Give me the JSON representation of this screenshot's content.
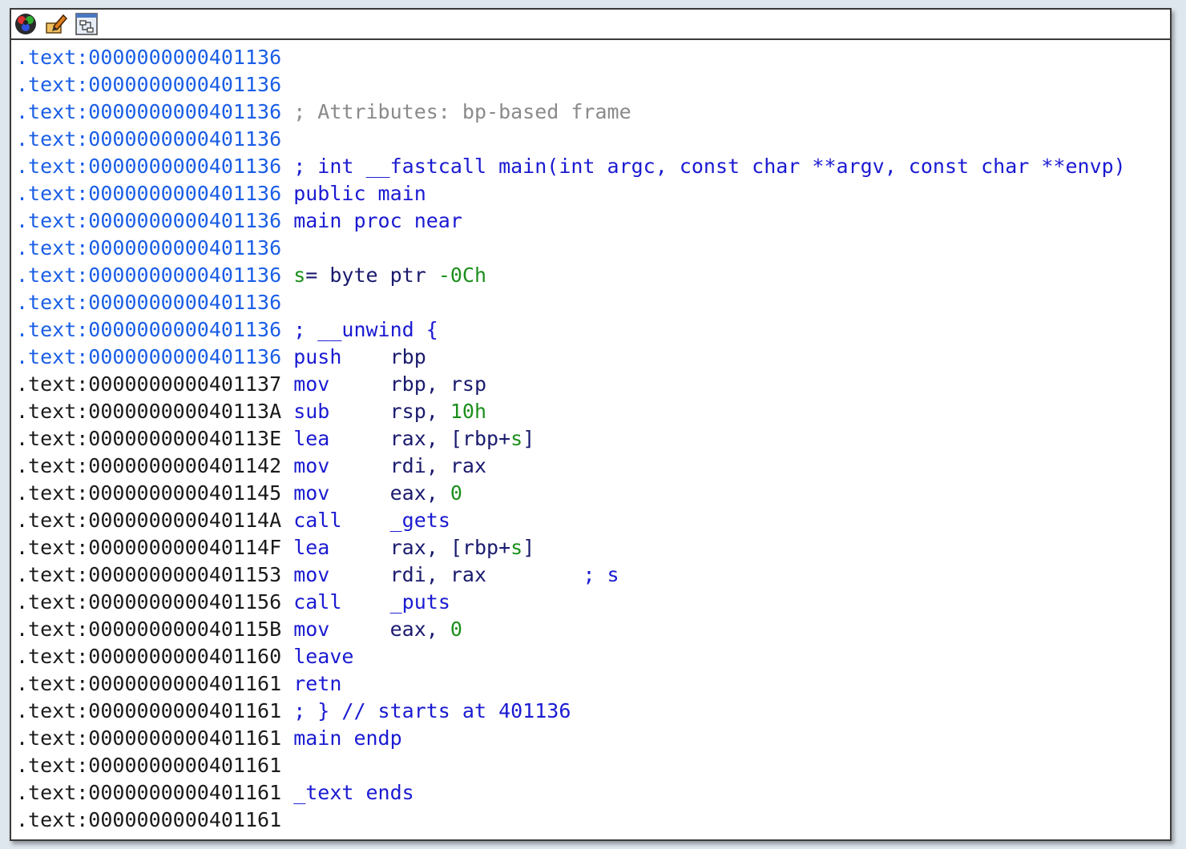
{
  "toolbar": {
    "icons": [
      "graph-view-icon",
      "edit-pencil-icon",
      "flowchart-icon"
    ]
  },
  "colors": {
    "address_blue": "#1a5ee6",
    "address_black": "#1a1a1a",
    "comment_gray": "#8a8a8a",
    "keyword_blue": "#1a1ad2",
    "number_green": "#1b8f1b"
  },
  "lines": [
    {
      "addr": ".text:0000000000401136",
      "addr_style": "blue",
      "parts": []
    },
    {
      "addr": ".text:0000000000401136",
      "addr_style": "blue",
      "parts": []
    },
    {
      "addr": ".text:0000000000401136",
      "addr_style": "blue",
      "parts": [
        {
          "t": " ; Attributes: bp-based frame",
          "c": "comment"
        }
      ]
    },
    {
      "addr": ".text:0000000000401136",
      "addr_style": "blue",
      "parts": []
    },
    {
      "addr": ".text:0000000000401136",
      "addr_style": "blue",
      "parts": [
        {
          "t": " ; int __fastcall main(int argc, const char **argv, const char **envp)",
          "c": "kw"
        }
      ]
    },
    {
      "addr": ".text:0000000000401136",
      "addr_style": "blue",
      "parts": [
        {
          "t": " public main",
          "c": "kw"
        }
      ]
    },
    {
      "addr": ".text:0000000000401136",
      "addr_style": "blue",
      "parts": [
        {
          "t": " main proc near",
          "c": "kw"
        }
      ]
    },
    {
      "addr": ".text:0000000000401136",
      "addr_style": "blue",
      "parts": []
    },
    {
      "addr": ".text:0000000000401136",
      "addr_style": "blue",
      "parts": [
        {
          "t": " s",
          "c": "var"
        },
        {
          "t": "= byte ptr ",
          "c": "reg"
        },
        {
          "t": "-0Ch",
          "c": "num"
        }
      ]
    },
    {
      "addr": ".text:0000000000401136",
      "addr_style": "blue",
      "parts": []
    },
    {
      "addr": ".text:0000000000401136",
      "addr_style": "blue",
      "parts": [
        {
          "t": " ; __unwind {",
          "c": "kw"
        }
      ]
    },
    {
      "addr": ".text:0000000000401136",
      "addr_style": "blue",
      "parts": [
        {
          "t": " push    ",
          "c": "ins"
        },
        {
          "t": "rbp",
          "c": "reg"
        }
      ]
    },
    {
      "addr": ".text:0000000000401137",
      "addr_style": "black",
      "parts": [
        {
          "t": " mov     ",
          "c": "ins"
        },
        {
          "t": "rbp, rsp",
          "c": "reg"
        }
      ]
    },
    {
      "addr": ".text:000000000040113A",
      "addr_style": "black",
      "parts": [
        {
          "t": " sub     ",
          "c": "ins"
        },
        {
          "t": "rsp, ",
          "c": "reg"
        },
        {
          "t": "10h",
          "c": "num"
        }
      ]
    },
    {
      "addr": ".text:000000000040113E",
      "addr_style": "black",
      "parts": [
        {
          "t": " lea     ",
          "c": "ins"
        },
        {
          "t": "rax, [rbp+",
          "c": "reg"
        },
        {
          "t": "s",
          "c": "var"
        },
        {
          "t": "]",
          "c": "reg"
        }
      ]
    },
    {
      "addr": ".text:0000000000401142",
      "addr_style": "black",
      "parts": [
        {
          "t": " mov     ",
          "c": "ins"
        },
        {
          "t": "rdi, rax",
          "c": "reg"
        }
      ]
    },
    {
      "addr": ".text:0000000000401145",
      "addr_style": "black",
      "parts": [
        {
          "t": " mov     ",
          "c": "ins"
        },
        {
          "t": "eax, ",
          "c": "reg"
        },
        {
          "t": "0",
          "c": "num"
        }
      ]
    },
    {
      "addr": ".text:000000000040114A",
      "addr_style": "black",
      "parts": [
        {
          "t": " call    ",
          "c": "ins"
        },
        {
          "t": "_gets",
          "c": "sym"
        }
      ]
    },
    {
      "addr": ".text:000000000040114F",
      "addr_style": "black",
      "parts": [
        {
          "t": " lea     ",
          "c": "ins"
        },
        {
          "t": "rax, [rbp+",
          "c": "reg"
        },
        {
          "t": "s",
          "c": "var"
        },
        {
          "t": "]",
          "c": "reg"
        }
      ]
    },
    {
      "addr": ".text:0000000000401153",
      "addr_style": "black",
      "parts": [
        {
          "t": " mov     ",
          "c": "ins"
        },
        {
          "t": "rdi, rax",
          "c": "reg"
        },
        {
          "t": "        ; s",
          "c": "ac"
        }
      ]
    },
    {
      "addr": ".text:0000000000401156",
      "addr_style": "black",
      "parts": [
        {
          "t": " call    ",
          "c": "ins"
        },
        {
          "t": "_puts",
          "c": "sym"
        }
      ]
    },
    {
      "addr": ".text:000000000040115B",
      "addr_style": "black",
      "parts": [
        {
          "t": " mov     ",
          "c": "ins"
        },
        {
          "t": "eax, ",
          "c": "reg"
        },
        {
          "t": "0",
          "c": "num"
        }
      ]
    },
    {
      "addr": ".text:0000000000401160",
      "addr_style": "black",
      "parts": [
        {
          "t": " leave",
          "c": "ins"
        }
      ]
    },
    {
      "addr": ".text:0000000000401161",
      "addr_style": "black",
      "parts": [
        {
          "t": " retn",
          "c": "ins"
        }
      ]
    },
    {
      "addr": ".text:0000000000401161",
      "addr_style": "black",
      "parts": [
        {
          "t": " ; } // starts at 401136",
          "c": "kw"
        }
      ]
    },
    {
      "addr": ".text:0000000000401161",
      "addr_style": "black",
      "parts": [
        {
          "t": " main endp",
          "c": "kw"
        }
      ]
    },
    {
      "addr": ".text:0000000000401161",
      "addr_style": "black",
      "parts": []
    },
    {
      "addr": ".text:0000000000401161",
      "addr_style": "black",
      "parts": [
        {
          "t": " _text ends",
          "c": "kw"
        }
      ]
    },
    {
      "addr": ".text:0000000000401161",
      "addr_style": "black",
      "parts": []
    }
  ]
}
